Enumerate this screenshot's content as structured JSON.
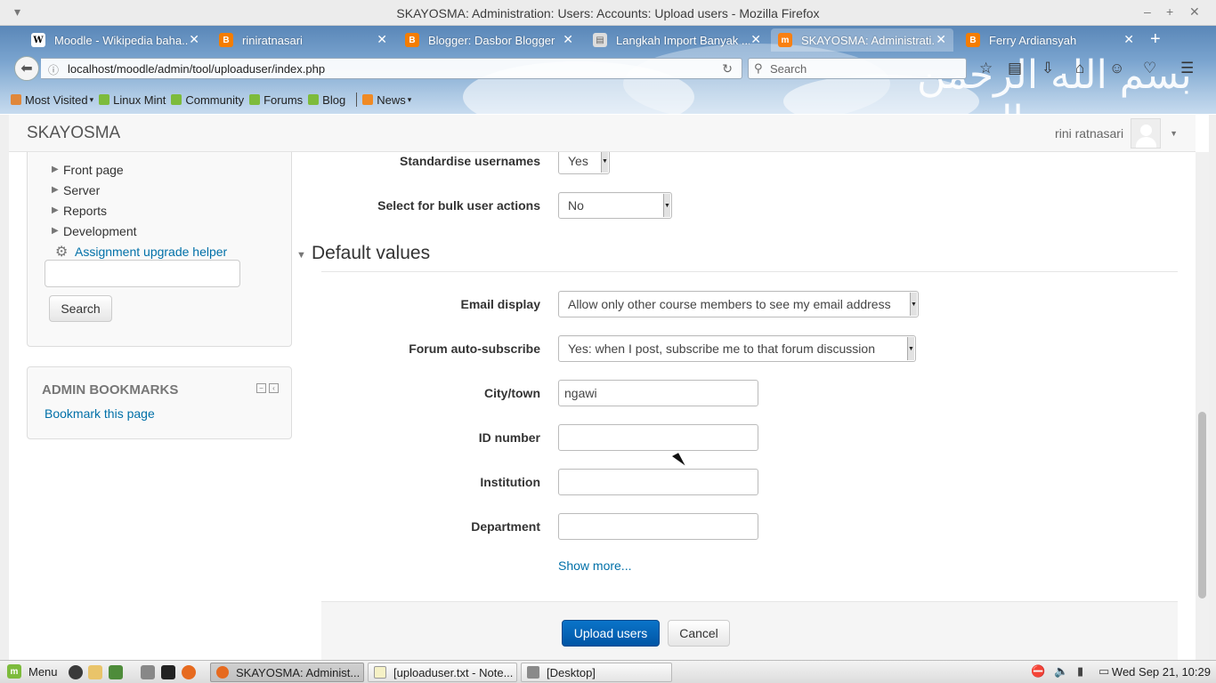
{
  "window": {
    "title": "SKAYOSMA: Administration: Users: Accounts: Upload users - Mozilla Firefox"
  },
  "tabs": [
    {
      "label": "Moodle - Wikipedia baha...",
      "favicon": "W",
      "color": "#ffffff"
    },
    {
      "label": "riniratnasari",
      "favicon": "B",
      "color": "#f57d00"
    },
    {
      "label": "Blogger: Dasbor Blogger",
      "favicon": "B",
      "color": "#f57d00"
    },
    {
      "label": "Langkah Import Banyak ...",
      "favicon": "doc",
      "color": "#dddddd"
    },
    {
      "label": "SKAYOSMA: Administrati...",
      "favicon": "m",
      "color": "#f98012"
    },
    {
      "label": "Ferry Ardiansyah",
      "favicon": "B",
      "color": "#f57d00"
    }
  ],
  "urlbar": {
    "url": "localhost/moodle/admin/tool/uploaduser/index.php",
    "search_placeholder": "Search"
  },
  "bookmarks": [
    {
      "label": "Most Visited",
      "dropdown": true,
      "color": "#e0873a"
    },
    {
      "label": "Linux Mint",
      "dropdown": false,
      "color": "#7dbb3c"
    },
    {
      "label": "Community",
      "dropdown": false,
      "color": "#7dbb3c"
    },
    {
      "label": "Forums",
      "dropdown": false,
      "color": "#7dbb3c"
    },
    {
      "label": "Blog",
      "dropdown": false,
      "color": "#7dbb3c"
    },
    {
      "label": "News",
      "dropdown": true,
      "color": "#f08a24"
    }
  ],
  "moodle": {
    "brand": "SKAYOSMA",
    "user_name": "rini ratnasari"
  },
  "admin_nav": {
    "items": [
      "Front page",
      "Server",
      "Reports",
      "Development"
    ],
    "helper_link": "Assignment upgrade helper",
    "search_value": "",
    "search_button": "Search"
  },
  "bookmarks_block": {
    "title": "ADMIN BOOKMARKS",
    "link": "Bookmark this page"
  },
  "form": {
    "fields_top": [
      {
        "label": "Standardise usernames",
        "value": "Yes"
      },
      {
        "label": "Select for bulk user actions",
        "value": "No"
      }
    ],
    "section_title": "Default values",
    "selects": [
      {
        "label": "Email display",
        "value": "Allow only other course members to see my email address"
      },
      {
        "label": "Forum auto-subscribe",
        "value": "Yes: when I post, subscribe me to that forum discussion"
      }
    ],
    "inputs": [
      {
        "label": "City/town",
        "value": "ngawi"
      },
      {
        "label": "ID number",
        "value": ""
      },
      {
        "label": "Institution",
        "value": ""
      },
      {
        "label": "Department",
        "value": ""
      }
    ],
    "show_more": "Show more...",
    "submit": "Upload users",
    "cancel": "Cancel"
  },
  "taskbar": {
    "menu": "Menu",
    "tasks": [
      {
        "label": "SKAYOSMA: Administ...",
        "active": true
      },
      {
        "label": "[uploaduser.txt - Note...",
        "active": false
      },
      {
        "label": "[Desktop]",
        "active": false
      }
    ],
    "clock": "Wed Sep 21, 10:29"
  },
  "colors": {
    "link": "#0070a8",
    "primary_button": "#0a6ac4"
  }
}
